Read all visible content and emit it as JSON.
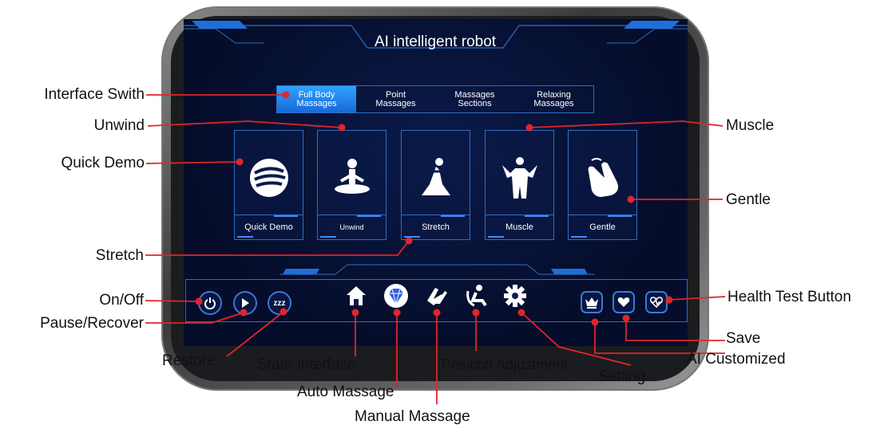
{
  "screen": {
    "title": "AI intelligent robot"
  },
  "tabs": [
    {
      "label": "Full Body\nMassages",
      "active": true
    },
    {
      "label": "Point\nMassages",
      "active": false
    },
    {
      "label": "Massages\nSections",
      "active": false
    },
    {
      "label": "Relaxing\nMassages",
      "active": false
    }
  ],
  "modes": [
    {
      "label": "Quick Demo",
      "icon": "hand-wave-icon"
    },
    {
      "label": "Unwind",
      "icon": "meditation-icon"
    },
    {
      "label": "Stretch",
      "icon": "stretch-pose-icon"
    },
    {
      "label": "Muscle",
      "icon": "muscle-body-icon"
    },
    {
      "label": "Gentle",
      "icon": "gentle-hand-icon"
    }
  ],
  "controls": {
    "power_icon": "power-icon",
    "play_icon": "play-icon",
    "sleep_icon": "zzz-icon",
    "sleep_glyph": "zzz",
    "home_icon": "home-icon",
    "auto_icon": "diamond-icon",
    "manual_icon": "hands-icon",
    "position_icon": "recline-icon",
    "setting_icon": "gear-icon",
    "ai_icon": "crown-icon",
    "save_icon": "heart-icon",
    "health_icon": "heart-pulse-icon"
  },
  "annotations": {
    "interface_switch": "Interface Swith",
    "unwind": "Unwind",
    "quick_demo": "Quick Demo",
    "stretch": "Stretch",
    "muscle": "Muscle",
    "gentle": "Gentle",
    "on_off": "On/Off",
    "pause_recover": "Pause/Recover",
    "restore": "Restore",
    "state_interface": "State Interface",
    "auto_massage": "Auto Massage",
    "manual_massage": "Manual Massage",
    "position_adjustment": "Position Adjustment",
    "setting": "Setting",
    "health_test": "Health Test Button",
    "save": "Save",
    "ai_customized": "AI Customized"
  },
  "colors": {
    "accent": "#2fa3ff",
    "screen_bg": "#050d2a",
    "callout": "#e0252b"
  }
}
